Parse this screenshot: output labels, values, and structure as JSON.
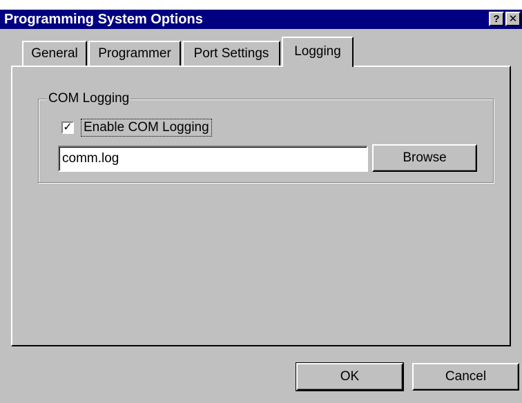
{
  "window": {
    "title": "Programming System Options",
    "help_label": "?",
    "close_label": "✕"
  },
  "tabs": [
    {
      "label": "General",
      "selected": false
    },
    {
      "label": "Programmer",
      "selected": false
    },
    {
      "label": "Port Settings",
      "selected": false
    },
    {
      "label": "Logging",
      "selected": true
    }
  ],
  "logging": {
    "group_label": "COM Logging",
    "enable_label": "Enable COM Logging",
    "enable_checked": true,
    "check_mark": "✓",
    "log_file_value": "comm.log",
    "browse_label": "Browse"
  },
  "footer": {
    "ok_label": "OK",
    "cancel_label": "Cancel"
  },
  "colors": {
    "titlebar": "#000080",
    "face": "#c0c0c0",
    "highlight": "#ffffff",
    "shadow": "#808080"
  }
}
